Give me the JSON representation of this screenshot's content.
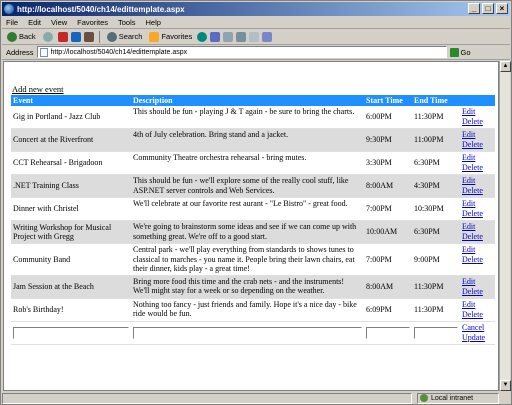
{
  "window": {
    "title": "http://localhost/5040/ch14/edittemplate.aspx"
  },
  "menu": [
    "File",
    "Edit",
    "View",
    "Favorites",
    "Tools",
    "Help"
  ],
  "toolbar": {
    "back": "Back",
    "search": "Search",
    "favorites": "Favorites"
  },
  "address": {
    "label": "Address",
    "url": "http://localhost/5040/ch14/edittemplate.aspx",
    "go": "Go"
  },
  "page": {
    "add_link": "Add new event",
    "headers": {
      "name": "Event",
      "description": "Description",
      "start": "Start Time",
      "end": "End Time"
    },
    "rows": [
      {
        "name": "Gig in Portland - Jazz Club",
        "description": "This should be fun - playing J & T again - be sure to bring the charts.",
        "start": "6:00PM",
        "end": "11:30PM",
        "edit": "Edit",
        "delete": "Delete"
      },
      {
        "name": "Concert at the Riverfront",
        "description": "4th of July celebration. Bring stand and a jacket.",
        "start": "9:30PM",
        "end": "11:00PM",
        "edit": "Edit",
        "delete": "Delete"
      },
      {
        "name": "CCT Rehearsal - Brigadoon",
        "description": "Community Theatre orchestra rehearsal - bring mutes.",
        "start": "3:30PM",
        "end": "6:30PM",
        "edit": "Edit",
        "delete": "Delete"
      },
      {
        "name": ".NET Training Class",
        "description": "This should be fun - we'll explore some of the really cool stuff, like ASP.NET server controls and Web Services.",
        "start": "8:00AM",
        "end": "4:30PM",
        "edit": "Edit",
        "delete": "Delete"
      },
      {
        "name": "Dinner with Christel",
        "description": "We'll celebrate at our favorite rest aurant - \"Le Bistro\" - great food.",
        "start": "7:00PM",
        "end": "10:30PM",
        "edit": "Edit",
        "delete": "Delete"
      },
      {
        "name": "Writing Workshop for Musical Project with Gregg",
        "description": "We're going to brainstorm some ideas and see if we can come up with something great. We're off to a good start.",
        "start": "10:00AM",
        "end": "6:30PM",
        "edit": "Edit",
        "delete": "Delete"
      },
      {
        "name": "Community Band",
        "description": "Central park - we'll play everything from standards to shows tunes to classical to marches - you name it. People bring their lawn chairs, eat their dinner, kids play - a great time!",
        "start": "7:00PM",
        "end": "9:00PM",
        "edit": "Edit",
        "delete": "Delete"
      },
      {
        "name": "Jam Session at the Beach",
        "description": "Bring more food this time and the crab nets - and the instruments! We'll might stay for a week or so depending on the weather.",
        "start": "8:00AM",
        "end": "11:30PM",
        "edit": "Edit",
        "delete": "Delete"
      },
      {
        "name": "Rob's Birthday!",
        "description": "Nothing too fancy - just friends and family. Hope it's a nice day - bike ride would be fun.",
        "start": "6:09PM",
        "end": "11:30PM",
        "edit": "Edit",
        "delete": "Delete"
      }
    ],
    "edit_row": {
      "name": "",
      "description": "",
      "start": "",
      "end": "",
      "cancel": "Cancel",
      "update": "Update"
    }
  },
  "status": {
    "zone": "Local intranet"
  }
}
